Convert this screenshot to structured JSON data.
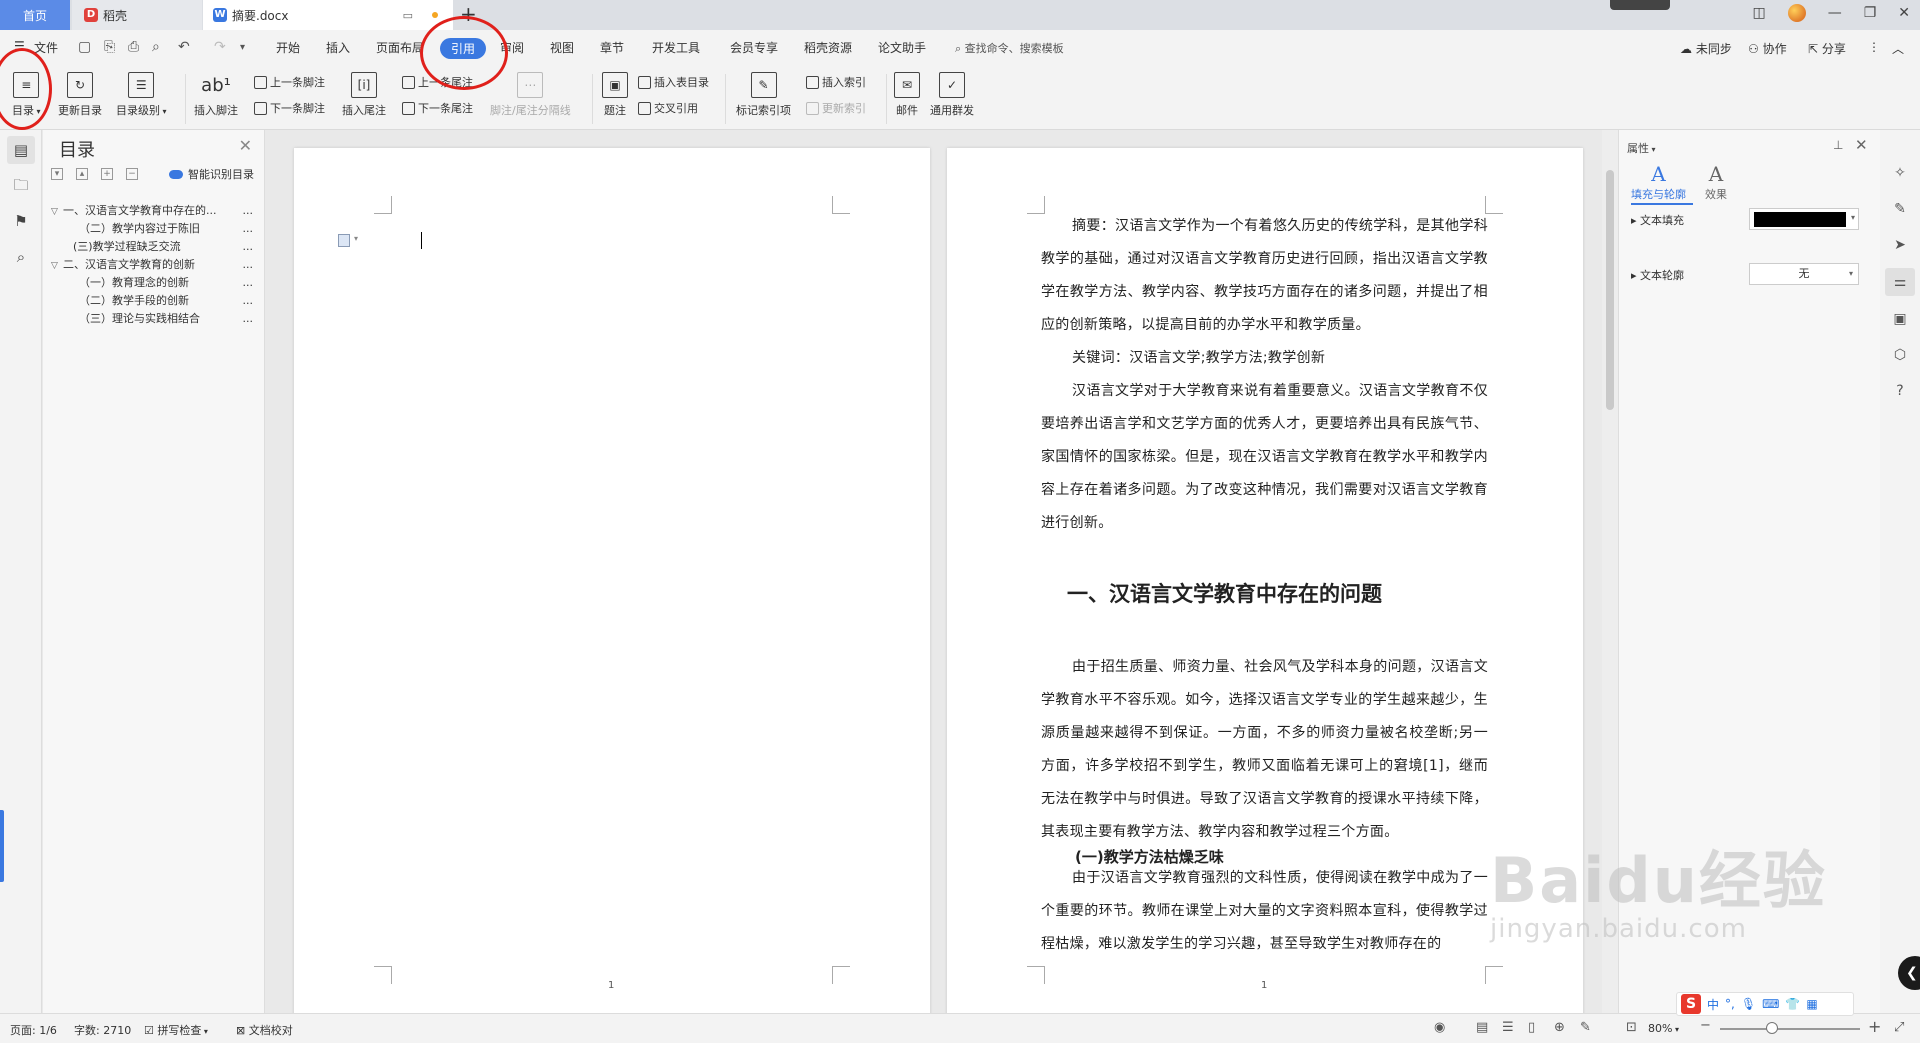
{
  "tabs": {
    "home": "首页",
    "daoke": "稻壳",
    "doc": "摘要.docx",
    "daoke_icon": "D",
    "doc_icon": "W"
  },
  "menu": {
    "file": "文件",
    "items": [
      "开始",
      "插入",
      "页面布局",
      "引用",
      "审阅",
      "视图",
      "章节",
      "开发工具",
      "会员专享",
      "稻壳资源",
      "论文助手"
    ],
    "active": "引用",
    "search": "查找命令、搜索模板",
    "unsynced": "未同步",
    "collab": "协作",
    "share": "分享"
  },
  "ribbon": {
    "toc": "目录",
    "update_toc": "更新目录",
    "toc_level": "目录级别",
    "insert_footnote": "插入脚注",
    "prev_footnote": "上一条脚注",
    "next_footnote": "下一条脚注",
    "insert_endnote": "插入尾注",
    "prev_endnote": "上一条尾注",
    "next_endnote": "下一条尾注",
    "footnote_sep": "脚注/尾注分隔线",
    "caption": "题注",
    "insert_table_of_figures": "插入表目录",
    "cross_ref": "交叉引用",
    "mark_index": "标记索引项",
    "insert_index": "插入索引",
    "update_index": "更新索引",
    "mail": "邮件",
    "mail_merge": "通用群发"
  },
  "toc_panel": {
    "title": "目录",
    "smart": "智能识别目录",
    "items": [
      {
        "text": "一、汉语言文学教育中存在的...",
        "level": 1,
        "arrow": "▽"
      },
      {
        "text": "（二）教学内容过于陈旧",
        "level": 2,
        "arrow": ""
      },
      {
        "text": "(三)教学过程缺乏交流",
        "level": 2,
        "arrow": ""
      },
      {
        "text": "二、汉语言文学教育的创新",
        "level": 1,
        "arrow": "▽"
      },
      {
        "text": "（一）教育理念的创新",
        "level": 2,
        "arrow": ""
      },
      {
        "text": "（二）教学手段的创新",
        "level": 2,
        "arrow": ""
      },
      {
        "text": "（三）理论与实践相结合",
        "level": 2,
        "arrow": ""
      }
    ],
    "dots": "..."
  },
  "document": {
    "page1_number": "1",
    "page2_number": "1",
    "abstract": "摘要：汉语言文学作为一个有着悠久历史的传统学科，是其他学科教学的基础，通过对汉语言文学教育历史进行回顾，指出汉语言文学教学在教学方法、教学内容、教学技巧方面存在的诸多问题，并提出了相应的创新策略，以提高目前的办学水平和教学质量。",
    "keywords": "关键词：汉语言文学;教学方法;教学创新",
    "intro": "汉语言文学对于大学教育来说有着重要意义。汉语言文学教育不仅要培养出语言学和文艺学方面的优秀人才，更要培养出具有民族气节、家国情怀的国家栋梁。但是，现在汉语言文学教育在教学水平和教学内容上存在着诸多问题。为了改变这种情况，我们需要对汉语言文学教育进行创新。",
    "heading1": "一、汉语言文学教育中存在的问题",
    "para1": "由于招生质量、师资力量、社会风气及学科本身的问题，汉语言文学教育水平不容乐观。如今，选择汉语言文学专业的学生越来越少，生源质量越来越得不到保证。一方面，不多的师资力量被名校垄断;另一方面，许多学校招不到学生，教师又面临着无课可上的窘境[1]，继而无法在教学中与时俱进。导致了汉语言文学教育的授课水平持续下降，其表现主要有教学方法、教学内容和教学过程三个方面。",
    "heading2": "(一)教学方法枯燥乏味",
    "para2": "由于汉语言文学教育强烈的文科性质，使得阅读在教学中成为了一个重要的环节。教师在课堂上对大量的文字资料照本宣科，使得教学过程枯燥，难以激发学生的学习兴趣，甚至导致学生对教师存在的"
  },
  "properties": {
    "title": "属性",
    "tab_fill": "填充与轮廓",
    "tab_effect": "效果",
    "text_fill": "文本填充",
    "text_outline": "文本轮廓",
    "outline_value": "无",
    "fill_color": "#000000",
    "tab_glyph": "A"
  },
  "status": {
    "page": "页面: 1/6",
    "words": "字数: 2710",
    "spell": "拼写检查",
    "proof": "文档校对",
    "zoom": "80%"
  },
  "ime": {
    "s": "S",
    "lang": "中"
  },
  "watermark": {
    "main": "Baidu经验",
    "sub": "jingyan.baidu.com"
  },
  "colors": {
    "accent": "#3a78e0",
    "annotation": "#e0201b"
  }
}
